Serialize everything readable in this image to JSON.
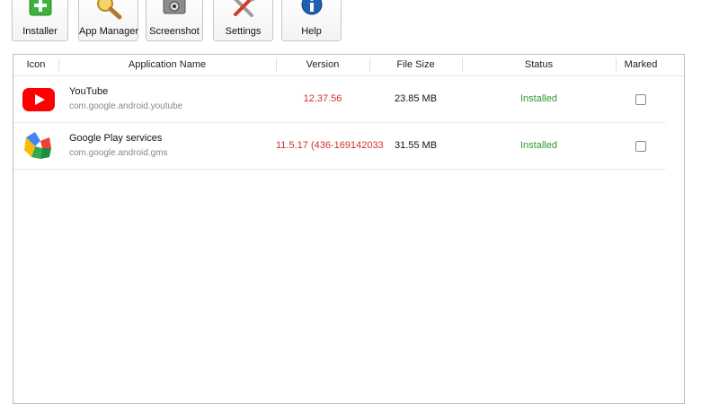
{
  "toolbar": {
    "buttons": [
      {
        "label": "Installer",
        "icon": "plus-icon"
      },
      {
        "label": "App Manager",
        "icon": "magnifier-icon"
      },
      {
        "label": "Screenshot",
        "icon": "camera-icon"
      },
      {
        "label": "Settings",
        "icon": "tools-icon"
      },
      {
        "label": "Help",
        "icon": "info-icon"
      }
    ]
  },
  "table": {
    "columns": [
      "Icon",
      "Application Name",
      "Version",
      "File Size",
      "Status",
      "Marked"
    ],
    "rows": [
      {
        "icon": "youtube-icon",
        "name": "YouTube",
        "package": "com.google.android.youtube",
        "version": "12.37.56",
        "size": "23.85 MB",
        "status": "Installed",
        "marked": false
      },
      {
        "icon": "google-play-services-icon",
        "name": "Google Play services",
        "package": "com.google.android.gms",
        "version": "11.5.17 (436-169142033",
        "size": "31.55 MB",
        "status": "Installed",
        "marked": false
      }
    ]
  },
  "colors": {
    "version_text": "#d0302a",
    "status_installed": "#2e9a2e",
    "youtube_red": "#ff0000"
  }
}
